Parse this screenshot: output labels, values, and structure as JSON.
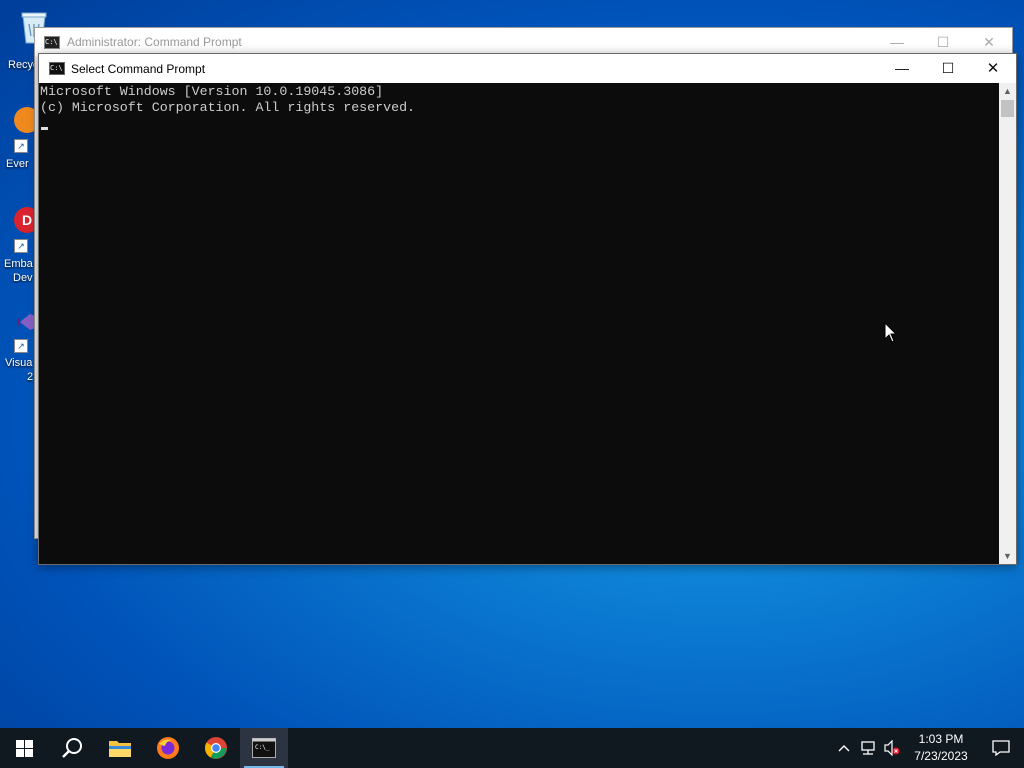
{
  "desktop": {
    "icons": [
      {
        "label": "Recycl"
      },
      {
        "label": "Ever"
      },
      {
        "label": "Emba",
        "label2": "Dev"
      },
      {
        "label": "Visua",
        "label2": "2"
      }
    ]
  },
  "background_window": {
    "title": "Administrator:  Command Prompt"
  },
  "window": {
    "title": "Select Command Prompt",
    "minimize": "—",
    "maximize": "☐",
    "close": "✕"
  },
  "console": {
    "lines": [
      "Microsoft Windows [Version 10.0.19045.3086]",
      "(c) Microsoft Corporation. All rights reserved."
    ]
  },
  "taskbar": {
    "apps": [
      "start-icon",
      "search-icon",
      "file-explorer-icon",
      "firefox-icon",
      "chrome-icon",
      "command-prompt-icon"
    ],
    "active_app": "command-prompt-icon",
    "clock_time": "1:03 PM",
    "clock_date": "7/23/2023"
  },
  "colors": {
    "console_bg": "#0c0c0c",
    "console_text": "#cccccc",
    "taskbar_bg": "#101820",
    "desktop_accent": "#0a78d0"
  }
}
